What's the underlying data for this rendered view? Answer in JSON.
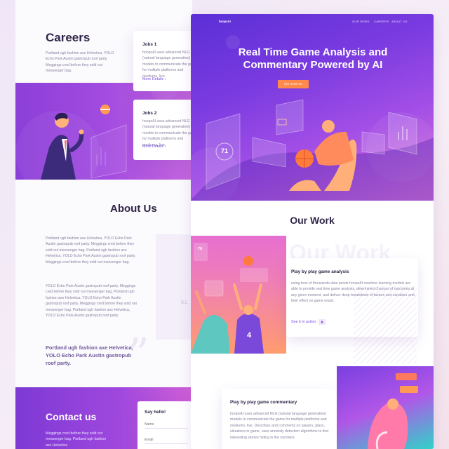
{
  "left": {
    "careers": {
      "title": "Careers",
      "text": "Portland ugh fashion axe Helvetica, YOLO Echo Park Austin gastropub roof party. Meggings cred before they sold out messenger bag.",
      "jobs": [
        {
          "title": "Jobs 1",
          "text": "hoopsAI uses advanced NLG (natural language generation) models to communicate the game for multiple platforms and mediums, live.",
          "link": "More Details ›"
        },
        {
          "title": "Jobs 2",
          "text": "hoopsAI uses advanced NLG (natural language generation) models to communicate the game for multiple platforms and mediums, live.",
          "link": "More Details ›"
        }
      ]
    },
    "about": {
      "title": "About Us",
      "para1": "Portland ugh fashion axe Helvetica, YOLO Echo Park Austin gastropub roof party. Meggings cred before they sold out messenger bag. Portland ugh fashion axe Helvetica, YOLO Echo Park Austin gastropub roof party. Meggings cred before they sold out messenger bag.",
      "para2": "YOLO Echo Park Austin gastropub roof party. Meggings cred before they sold out messenger bag. Portland ugh fashion axe Helvetica, YOLO Echo Park Austin gastropub roof party. Meggings cred before they sold out messenger bag. Portland ugh fashion axe Helvetica, YOLO Echo Park Austin gastropub roof party.",
      "quote": "Portland ugh fashion axe Helvetica, YOLO Echo Park Austin gastropub roof party.",
      "badge": "ILL"
    },
    "contact": {
      "title": "Contact us",
      "text": "Meggings cred before they sold out messenger bag. Portland ugh fashion axe Helvetica",
      "form_title": "Say hello!",
      "name_placeholder": "Name",
      "email_placeholder": "Email"
    }
  },
  "right": {
    "nav": {
      "logo": "hoopsAI",
      "items": [
        "OUR WORK",
        "CAREERS",
        "ABOUT US"
      ]
    },
    "hero": {
      "title": "Real Time Game Analysis and Commentary Powered by AI",
      "cta": "GET STARTED",
      "score": "71"
    },
    "our_work": {
      "title": "Our Work",
      "ghost": "Our Work",
      "jersey": "4",
      "stat": "76",
      "card1": {
        "title": "Play by play game analysis",
        "text": "using tens of thousands data points hoopsAI machine learning models are able to provide real time game analysis, determined chances of outcomes at any given moment, and deliver deep breakdown of factors and variables and their effect on game result.",
        "link": "See it in action"
      },
      "card2": {
        "title": "Play by play game commentary",
        "text": "hoopsAI uses advanced NLG (natural language generation) models to communicate the game for multiple platforms and mediums, live. Describes and comments on players, plays, situations in game, uses anomaly detection algorithms to find interesting stories hiding in the numbers."
      }
    }
  },
  "colors": {
    "accent": "#7b4fe0",
    "cta": "#ff8a4c",
    "heading": "#2f2447"
  }
}
